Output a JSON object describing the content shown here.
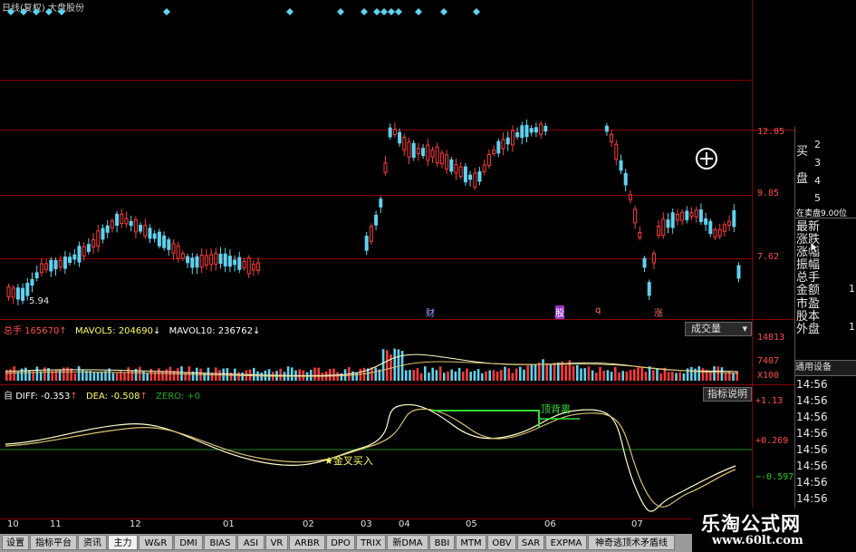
{
  "main_chart": {
    "title_label": "日线(复权) 大盘股份",
    "low_price_marker": "5.94",
    "price_axis": [
      "12.05",
      "9.85",
      "7.62"
    ],
    "event_markers": [
      "财",
      "股",
      "q",
      "涨"
    ]
  },
  "volume_panel": {
    "label": "总手",
    "value": "165670",
    "mavol5_label": "MAVOL5:",
    "mavol5_value": "204690",
    "mavol10_label": "MAVOL10:",
    "mavol10_value": "236762",
    "dropdown_label": "成交量",
    "axis": [
      "14813",
      "7407",
      "X100"
    ]
  },
  "macd_panel": {
    "label": "自",
    "diff_label": "DIFF:",
    "diff_value": "-0.353",
    "dea_label": "DEA:",
    "dea_value": "-0.508",
    "zero_label": "ZERO: +0",
    "button_label": "指标说明",
    "axis": [
      "1.13",
      "0.269",
      "-0.597"
    ],
    "golden_cross_label": "金叉买入",
    "divergence_label": "顶背离"
  },
  "time_axis": [
    "10",
    "11",
    "12",
    "01",
    "02",
    "03",
    "04",
    "05",
    "06",
    "07"
  ],
  "right_panel": {
    "buy_sell": [
      "买",
      "盘"
    ],
    "level_numbers": [
      "2",
      "3",
      "4",
      "5"
    ],
    "pending_sell": "在卖盘9.00位",
    "fields": [
      "最新",
      "涨跌",
      "涨幅",
      "振幅",
      "总手",
      "金额",
      "市盈",
      "股本",
      "外盘"
    ],
    "field_values": [
      "1",
      "1"
    ],
    "settings_label": "通用设备",
    "times": [
      "14:56",
      "14:56",
      "14:56",
      "14:56",
      "14:56",
      "14:56",
      "14:56",
      "14:56"
    ]
  },
  "tabs": [
    "设置",
    "指标平台",
    "资讯",
    "主力",
    "W&R",
    "DMI",
    "BIAS",
    "ASI",
    "VR",
    "ARBR",
    "DPO",
    "TRIX",
    "新DMA",
    "BBI",
    "MTM",
    "OBV",
    "SAR",
    "EXPMA",
    "神奇逃顶术矛盾线"
  ],
  "watermark": {
    "title": "乐淘公式网",
    "url": "www.60lt.com"
  },
  "colors": {
    "up": "#ff3b3b",
    "down": "#5fd3f0",
    "grid": "#8a0000",
    "diff_line": "#ffffcc",
    "dea_line": "#d8c070"
  }
}
